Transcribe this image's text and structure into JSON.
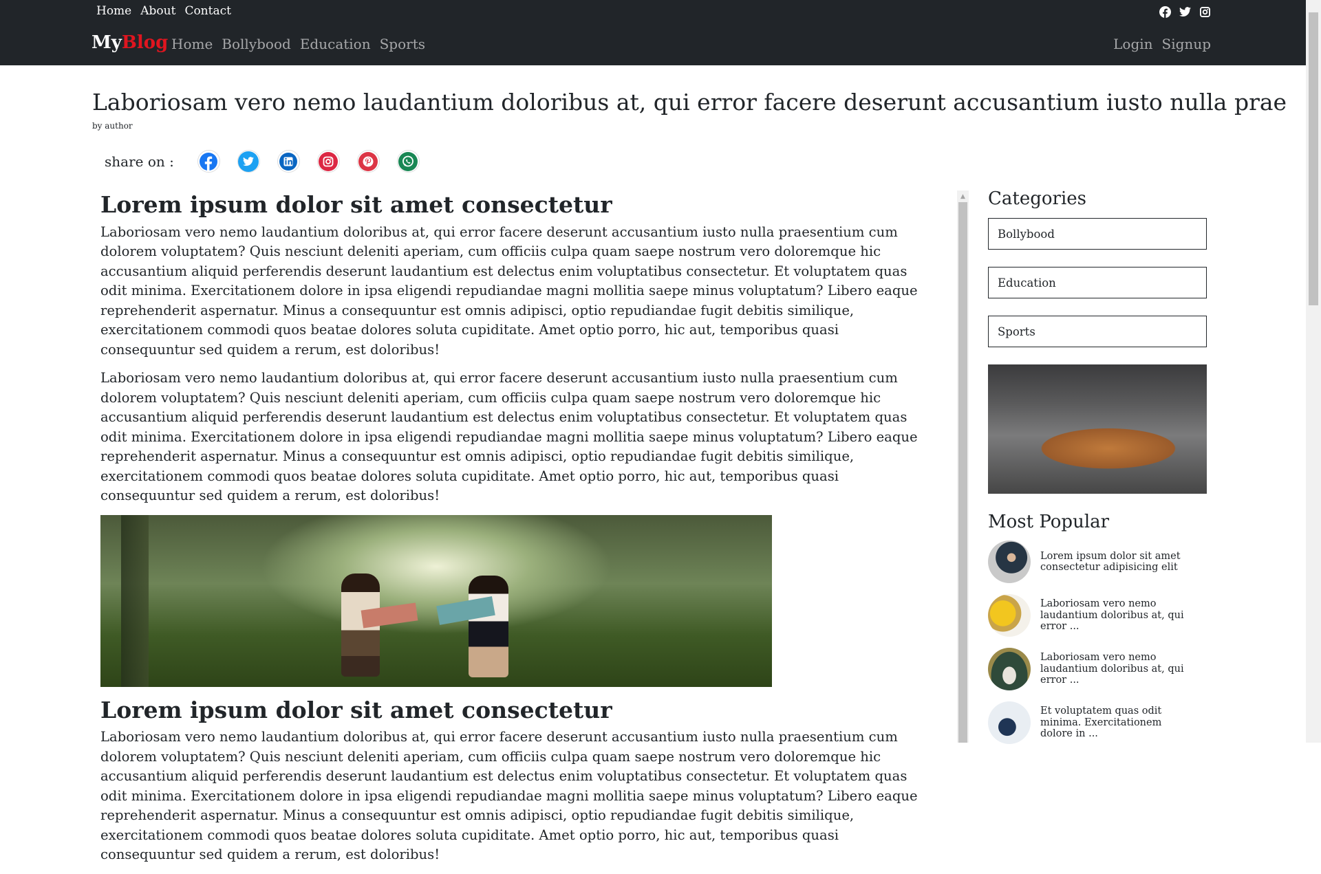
{
  "top_links": [
    "Home",
    "About",
    "Contact"
  ],
  "brand": {
    "part1": "My",
    "part2": "Blog"
  },
  "main_nav": [
    "Home",
    "Bollybood",
    "Education",
    "Sports"
  ],
  "auth": {
    "login": "Login",
    "signup": "Signup"
  },
  "post": {
    "title": "Laboriosam vero nemo laudantium doloribus at, qui error facere deserunt accusantium iusto nulla prae",
    "author": "by author",
    "share_label": "share on :"
  },
  "share_icons": [
    {
      "name": "facebook-icon",
      "color": "#1877f2"
    },
    {
      "name": "twitter-icon",
      "color": "#1da1f2"
    },
    {
      "name": "linkedin-icon",
      "color": "#0a66c2"
    },
    {
      "name": "instagram-icon",
      "color": "#dc2743"
    },
    {
      "name": "pinterest-icon",
      "color": "#e60023"
    },
    {
      "name": "whatsapp-icon",
      "color": "#198754"
    }
  ],
  "article": {
    "heading1": "Lorem ipsum dolor sit amet consectetur",
    "para": "Laboriosam vero nemo laudantium doloribus at, qui error facere deserunt accusantium iusto nulla praesentium cum dolorem voluptatem? Quis nesciunt deleniti aperiam, cum officiis culpa quam saepe nostrum vero doloremque hic accusantium aliquid perferendis deserunt laudantium est delectus enim voluptatibus consectetur. Et voluptatem quas odit minima. Exercitationem dolore in ipsa eligendi repudiandae magni mollitia saepe minus voluptatum? Libero eaque reprehenderit aspernatur. Minus a consequuntur est omnis adipisci, optio repudiandae fugit debitis similique, exercitationem commodi quos beatae dolores soluta cupiditate. Amet optio porro, hic aut, temporibus quasi consequuntur sed quidem a rerum, est doloribus!",
    "heading2": "Lorem ipsum dolor sit amet consectetur"
  },
  "sidebar": {
    "categories_heading": "Categories",
    "categories": [
      "Bollybood",
      "Education",
      "Sports"
    ],
    "popular_heading": "Most Popular",
    "popular": [
      "Lorem ipsum dolor sit amet consectetur adipisicing elit",
      "Laboriosam vero nemo laudantium doloribus at, qui error ...",
      "Laboriosam vero nemo laudantium doloribus at, qui error ...",
      "Et voluptatem quas odit minima. Exercitationem dolore in ..."
    ]
  }
}
